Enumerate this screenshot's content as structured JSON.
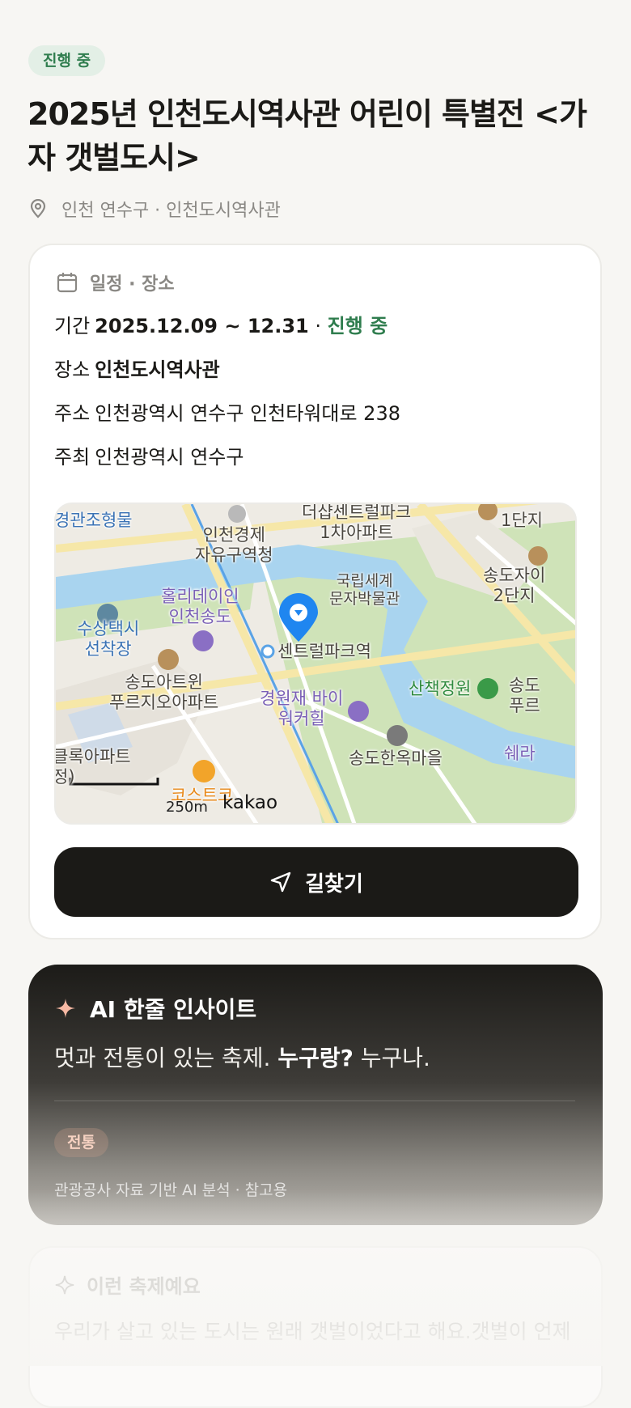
{
  "header": {
    "status_badge": "진행 중",
    "title": "2025년 인천도시역사관 어린이 특별전 <가자 갯벌도시>",
    "location": "인천 연수구 · 인천도시역사관"
  },
  "schedule_card": {
    "heading": "일정 · 장소",
    "period_label": "기간",
    "period_value": "2025.12.09 ~ 12.31",
    "period_sep": " · ",
    "period_status": "진행 중",
    "venue_label": "장소",
    "venue_value": "인천도시역사관",
    "address_label": "주소",
    "address_value": "인천광역시 연수구 인천타워대로 238",
    "host_label": "주최",
    "host_value": "인천광역시 연수구",
    "map": {
      "labels": [
        "경관조형물",
        "인천경제\n자유구역청",
        "더샵센트럴파크\n1차아파트",
        "1단지",
        "국립세계\n문자박물관",
        "송도자이\n2단지",
        "홀리데이인\n인천송도",
        "수상택시\n선착장",
        "센트럴파크역",
        "송도아트윈\n푸르지오아파트",
        "경원재 바이\n워커힐",
        "산책정원",
        "송도\n푸르",
        "쉐라",
        "송도한옥마을",
        "클록아파트\n정)",
        "코스트코"
      ],
      "scale": "250m",
      "brand": "kakao"
    },
    "route_button": "길찾기"
  },
  "ai_card": {
    "heading": "AI 한줄 인사이트",
    "text_a": "멋과 전통이 있는 축제. ",
    "text_b": "누구랑?",
    "text_c": " 누구나.",
    "tag": "전통",
    "note": "관광공사 자료 기반 AI 분석 · 참고용"
  },
  "about_card": {
    "heading": "이런 축제예요",
    "body": "우리가 살고 있는 도시는 원래 갯벌이었다고 해요.갯벌이 언제"
  },
  "colors": {
    "accent_green": "#2f7d4e",
    "dark": "#1b1a17",
    "map_pin": "#1f86f0"
  }
}
